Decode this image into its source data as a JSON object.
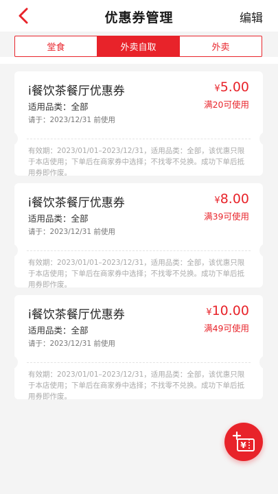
{
  "header": {
    "title": "优惠券管理",
    "edit_label": "编辑"
  },
  "tabs": [
    {
      "label": "堂食",
      "active": false
    },
    {
      "label": "外卖自取",
      "active": true
    },
    {
      "label": "外卖",
      "active": false
    }
  ],
  "coupons": [
    {
      "name": "i餐饮茶餐厅优惠券",
      "currency": "¥",
      "amount": "5.00",
      "condition": "满20可使用",
      "category": "适用品类：全部",
      "expiry": "请于：2023/12/31 前使用",
      "description": "有效期：2023/01/01–2023/12/31，适用品类：全部，该优惠只限于本店使用；下单后在商家券中选择；不找零不兑换。成功下单后抵用券即作废。"
    },
    {
      "name": "i餐饮茶餐厅优惠券",
      "currency": "¥",
      "amount": "8.00",
      "condition": "满39可使用",
      "category": "适用品类：全部",
      "expiry": "请于：2023/12/31 前使用",
      "description": "有效期：2023/01/01–2023/12/31，适用品类：全部，该优惠只限于本店使用；下单后在商家券中选择；不找零不兑换。成功下单后抵用券即作废。"
    },
    {
      "name": "i餐饮茶餐厅优惠券",
      "currency": "¥",
      "amount": "10.00",
      "condition": "满49可使用",
      "category": "适用品类：全部",
      "expiry": "请于：2023/12/31 前使用",
      "description": "有效期：2023/01/01–2023/12/31，适用品类：全部，该优惠只限于本店使用；下单后在商家券中选择；不找零不兑换。成功下单后抵用券即作废。"
    }
  ],
  "fab": {
    "icon": "add-coupon-icon",
    "glyph": "¥"
  },
  "colors": {
    "accent": "#e8232a",
    "background": "#f4f4f4"
  }
}
